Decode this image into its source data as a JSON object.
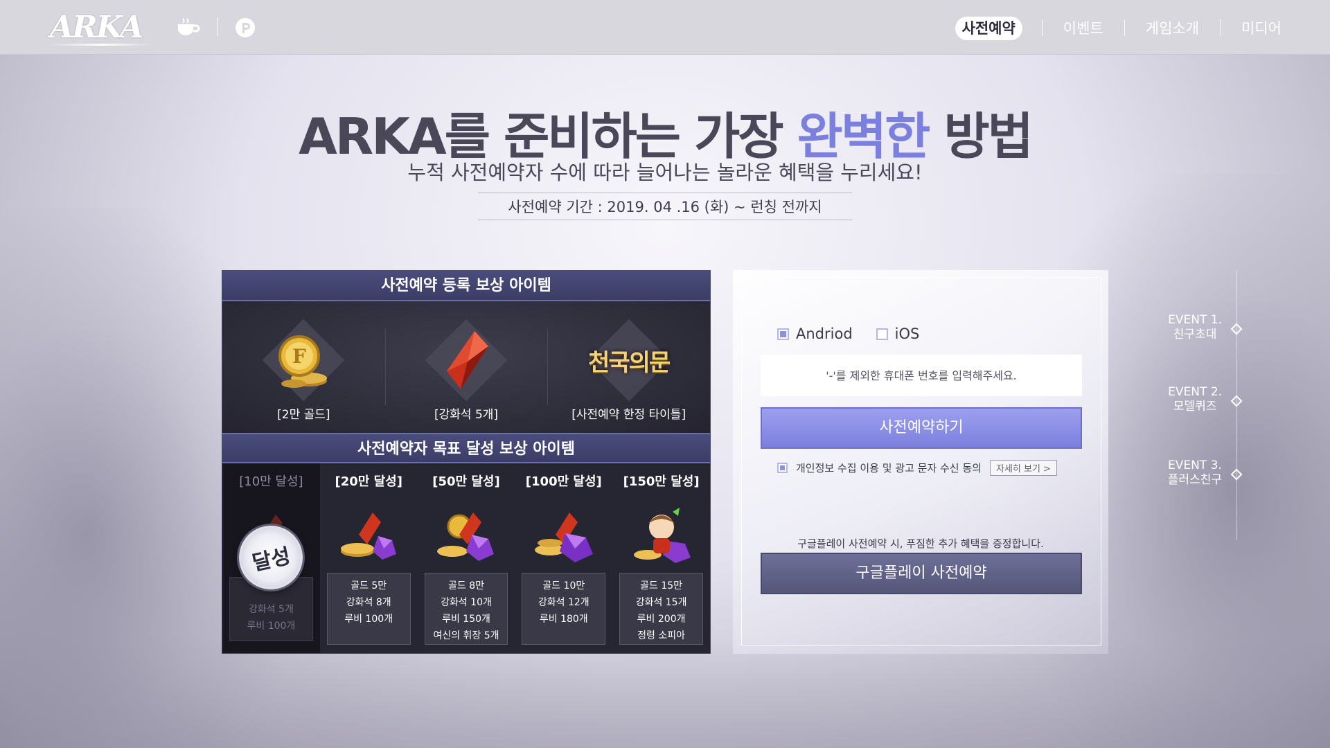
{
  "header": {
    "logo": "ARKA",
    "nav": [
      {
        "label": "사전예약",
        "active": true
      },
      {
        "label": "이벤트",
        "active": false
      },
      {
        "label": "게임소개",
        "active": false
      },
      {
        "label": "미디어",
        "active": false
      }
    ],
    "icons": [
      "cafe-cup-icon",
      "p-circle-icon"
    ]
  },
  "hero": {
    "title_pre": "ARKA를 준비하는 가장 ",
    "title_highlight": "완벽한",
    "title_post": " 방법",
    "subtitle": "누적 사전예약자 수에 따라 늘어나는 놀라운 혜택을 누리세요!",
    "period": "사전예약 기간 : 2019. 04 .16 (화) ~ 런칭 전까지"
  },
  "rewards": {
    "register_title": "사전예약 등록 보상 아이템",
    "register_items": [
      {
        "label": "[2만 골드]",
        "icon": "gold-coin-icon"
      },
      {
        "label": "[강화석 5개]",
        "icon": "red-gem-icon"
      },
      {
        "label": "[사전예약 한정 타이틀]",
        "icon": "title-emblem-icon",
        "emblem": "천국의문"
      }
    ],
    "goal_title": "사전예약자 목표 달성 보상 아이템",
    "goals": [
      {
        "title": "[10만 달성]",
        "done": true,
        "stamp": "달성",
        "lines": [
          "강화석 5개",
          "루비 100개"
        ]
      },
      {
        "title": "[20만 달성]",
        "done": false,
        "lines": [
          "골드 5만",
          "강화석 8개",
          "루비 100개"
        ]
      },
      {
        "title": "[50만 달성]",
        "done": false,
        "lines": [
          "골드 8만",
          "강화석 10개",
          "루비 150개",
          "여신의 휘장 5개"
        ]
      },
      {
        "title": "[100만 달성]",
        "done": false,
        "lines": [
          "골드 10만",
          "강화석 12개",
          "루비 180개"
        ]
      },
      {
        "title": "[150만 달성]",
        "done": false,
        "lines": [
          "골드 15만",
          "강화석 15개",
          "루비 200개",
          "정령 소피아"
        ]
      }
    ]
  },
  "register": {
    "os_options": [
      {
        "label": "Andriod",
        "checked": true
      },
      {
        "label": "iOS",
        "checked": false
      }
    ],
    "phone_placeholder": "'-'를 제외한 휴대폰 번호를 입력해주세요.",
    "submit_label": "사전예약하기",
    "agree_label": "개인정보 수집 이용 및 광고 문자 수신 동의",
    "agree_checked": true,
    "detail_label": "자세히 보기 >",
    "gp_note": "구글플레이 사전예약 시, 푸짐한 추가 혜택을 증정합니다.",
    "gp_label": "구글플레이 사전예약"
  },
  "events": [
    {
      "num": "EVENT 1.",
      "name": "친구초대"
    },
    {
      "num": "EVENT 2.",
      "name": "모델퀴즈"
    },
    {
      "num": "EVENT 3.",
      "name": "플러스친구"
    }
  ],
  "colors": {
    "accent": "#7b7fdd",
    "panel_dark": "#262532",
    "header_bg": "#d8d7de",
    "button_primary": "#8b8ee6",
    "button_secondary": "#5f6086"
  }
}
